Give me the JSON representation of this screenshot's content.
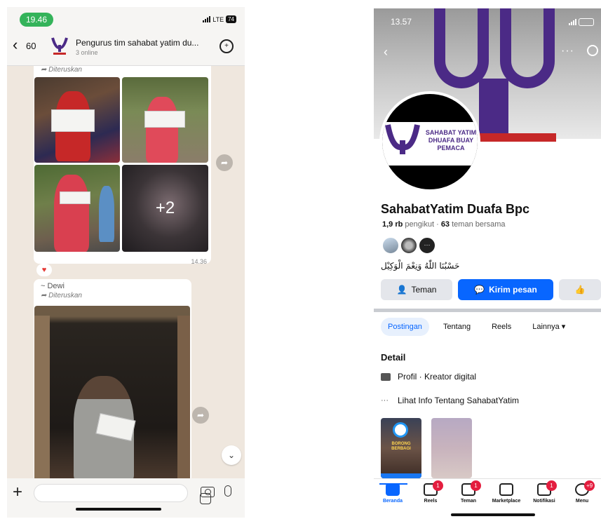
{
  "whatsapp": {
    "status_time": "19.46",
    "network": "LTE",
    "battery": "74",
    "back_count": "60",
    "group_title": "Pengurus tim sahabat yatim du...",
    "group_subtitle": "3 online",
    "forwarded_label_1": "Diteruskan",
    "more_photos": "+2",
    "message_time_1": "14.36",
    "reaction": "♥",
    "sender_2": "~ Dewi",
    "forwarded_label_2": "Diteruskan",
    "colors": {
      "header": "#f6f5f3",
      "chat_bg": "#efe7de",
      "status_pill": "#34b35a"
    }
  },
  "facebook": {
    "status_time": "13.57",
    "avatar_text": "SAHABAT YATIM DHUAFA BUAY PEMACA",
    "page_name": "SahabatYatim Duafa Bpc",
    "followers_count": "1,9 rb",
    "followers_label": "pengikut",
    "mutual_count": "63",
    "mutual_label": "teman bersama",
    "bio_arabic": "حَسْبُنَا اللّٰهُ وَنِعْمَ الْوَكِيْل",
    "btn_friend": "Teman",
    "btn_message": "Kirim pesan",
    "tabs": [
      "Postingan",
      "Tentang",
      "Reels",
      "Lainnya ▾"
    ],
    "detail_title": "Detail",
    "detail_profile": "Profil · Kreator digital",
    "detail_info": "Lihat Info Tentang SahabatYatim",
    "thumb_text": "BORONG BERBAGI",
    "nav": [
      {
        "label": "Beranda",
        "badge": ""
      },
      {
        "label": "Reels",
        "badge": "1"
      },
      {
        "label": "Teman",
        "badge": "1"
      },
      {
        "label": "Marketplace",
        "badge": ""
      },
      {
        "label": "Notifikasi",
        "badge": "1"
      },
      {
        "label": "Menu",
        "badge": "+9"
      }
    ],
    "colors": {
      "primary": "#0866ff",
      "logo_purple": "#4b2a86",
      "badge": "#e41e3f"
    }
  }
}
